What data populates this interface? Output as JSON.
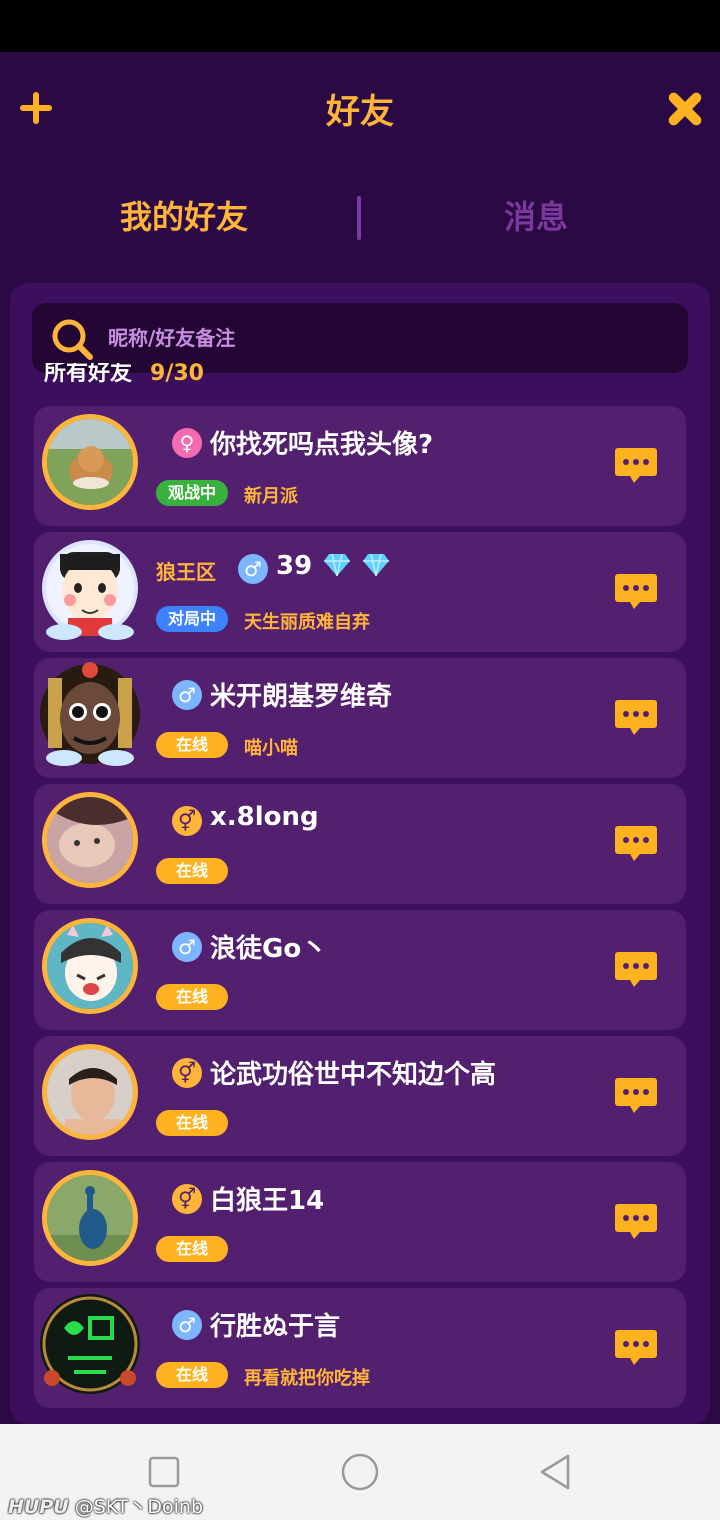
{
  "header": {
    "title": "好友",
    "add_icon": "plus-icon",
    "close_icon": "close-icon",
    "accent": "#ffb43a"
  },
  "tabs": [
    {
      "label": "我的好友",
      "active": true
    },
    {
      "label": "消息",
      "active": false
    }
  ],
  "search": {
    "placeholder": "昵称/好友备注"
  },
  "friends_count": {
    "label": "所有好友",
    "value": "9/30"
  },
  "friends": [
    {
      "name": "你找死吗点我头像?",
      "gender": "female",
      "gender_symbol": "♀",
      "status": "观战中",
      "remark": "新月派",
      "region": ""
    },
    {
      "name": "39",
      "gender": "male",
      "gender_symbol": "♂",
      "status": "对局中",
      "remark": "天生丽质难自弃",
      "region": "狼王区",
      "gems": 2
    },
    {
      "name": "米开朗基罗维奇",
      "gender": "male",
      "gender_symbol": "♂",
      "status": "在线",
      "remark": "喵小喵",
      "region": ""
    },
    {
      "name": "x.8long",
      "gender": "unknown",
      "gender_symbol": "⚥",
      "status": "在线",
      "remark": "",
      "region": ""
    },
    {
      "name": "浪徒Go丶",
      "gender": "male",
      "gender_symbol": "♂",
      "status": "在线",
      "remark": "",
      "region": ""
    },
    {
      "name": "论武功俗世中不知边个高",
      "gender": "unknown",
      "gender_symbol": "⚥",
      "status": "在线",
      "remark": "",
      "region": ""
    },
    {
      "name": "白狼王14",
      "gender": "unknown",
      "gender_symbol": "⚥",
      "status": "在线",
      "remark": "",
      "region": ""
    },
    {
      "name": "行胜ぬ于言",
      "gender": "male",
      "gender_symbol": "♂",
      "status": "在线",
      "remark": "再看就把你吃掉",
      "region": ""
    }
  ],
  "watermark": {
    "brand": "HUPU",
    "user": "@SKT丶Doinb"
  }
}
